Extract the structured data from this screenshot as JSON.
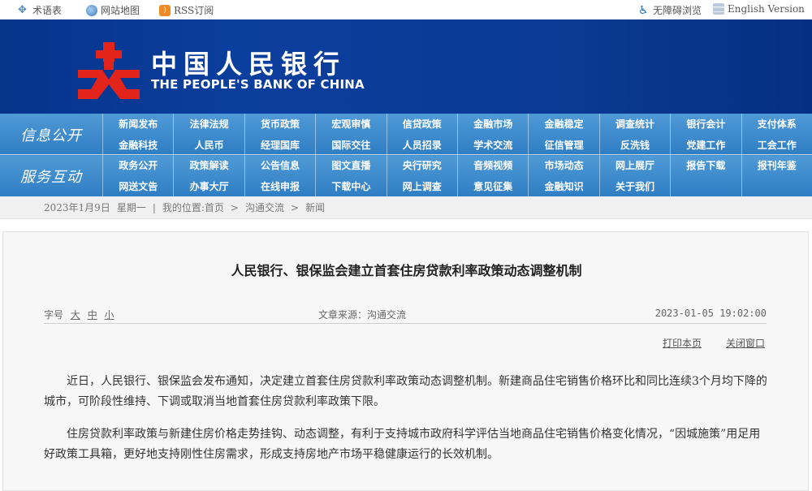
{
  "topbar": {
    "sitemap_label": "术语表",
    "map_label": "网站地图",
    "rss_label": "RSS订阅",
    "accessible_label": "无障碍浏览",
    "english_label": "English Version"
  },
  "banner": {
    "name_cn": "中国人民银行",
    "name_en": "THE PEOPLE'S BANK OF CHINA",
    "logo_color": "#e3241b"
  },
  "nav": {
    "section1": "信息公开",
    "section2": "服务互动",
    "row1": [
      "新闻发布",
      "法律法规",
      "货币政策",
      "宏观审慎",
      "信贷政策",
      "金融市场",
      "金融稳定",
      "调查统计",
      "银行会计",
      "支付体系"
    ],
    "row2": [
      "金融科技",
      "人民币",
      "经理国库",
      "国际交往",
      "人员招录",
      "学术交流",
      "征信管理",
      "反洗钱",
      "党建工作",
      "工会工作"
    ],
    "row3": [
      "政务公开",
      "政策解读",
      "公告信息",
      "图文直播",
      "央行研究",
      "音频视频",
      "市场动态",
      "网上展厅",
      "报告下载",
      "报刊年鉴"
    ],
    "row4": [
      "网送文告",
      "办事大厅",
      "在线申报",
      "下载中心",
      "网上调查",
      "意见征集",
      "金融知识",
      "关于我们",
      "",
      ""
    ]
  },
  "breadcrumb": {
    "date": "2023年1月9日",
    "weekday": "星期一",
    "location_prefix": "我的位置:首页",
    "level1": "沟通交流",
    "level2": "新闻",
    "separator": ">"
  },
  "article": {
    "title": "人民银行、银保监会建立首套住房贷款利率政策动态调整机制",
    "font_size_label": "字号",
    "font_large": "大",
    "font_medium": "中",
    "font_small": "小",
    "source": "文章来源：沟通交流",
    "date": "2023-01-05 19:02:00",
    "print_label": "打印本页",
    "close_label": "关闭窗口",
    "para1": "近日，人民银行、银保监会发布通知，决定建立首套住房贷款利率政策动态调整机制。新建商品住宅销售价格环比和同比连续3个月均下降的城市，可阶段性维持、下调或取消当地首套住房贷款利率政策下限。",
    "para2": "住房贷款利率政策与新建住房价格走势挂钩、动态调整，有利于支持城市政府科学评估当地商品住宅销售价格变化情况，“因城施策”用足用好政策工具箱，更好地支持刚性住房需求，形成支持房地产市场平稳健康运行的长效机制。"
  }
}
